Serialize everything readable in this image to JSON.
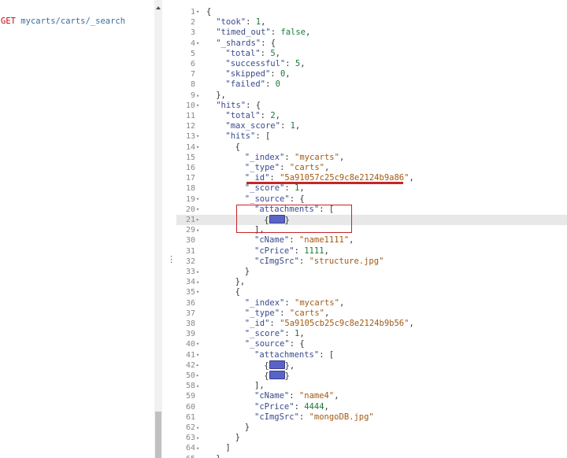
{
  "request": {
    "method": "GET",
    "path": "mycarts/carts/_search"
  },
  "colors": {
    "method": "#c5060b",
    "path": "#3a6e9e",
    "annotation": "#c7242a",
    "folded_badge": "#5a63c7"
  },
  "lines": [
    {
      "n": "1",
      "fold": "down",
      "indent": 0,
      "tokens": [
        [
          "punc",
          "{"
        ]
      ]
    },
    {
      "n": "2",
      "indent": 1,
      "tokens": [
        [
          "key",
          "\"took\""
        ],
        [
          "punc",
          ": "
        ],
        [
          "num",
          "1"
        ],
        [
          "punc",
          ","
        ]
      ]
    },
    {
      "n": "3",
      "indent": 1,
      "tokens": [
        [
          "key",
          "\"timed_out\""
        ],
        [
          "punc",
          ": "
        ],
        [
          "bool",
          "false"
        ],
        [
          "punc",
          ","
        ]
      ]
    },
    {
      "n": "4",
      "fold": "down",
      "indent": 1,
      "tokens": [
        [
          "key",
          "\"_shards\""
        ],
        [
          "punc",
          ": {"
        ]
      ]
    },
    {
      "n": "5",
      "indent": 2,
      "tokens": [
        [
          "key",
          "\"total\""
        ],
        [
          "punc",
          ": "
        ],
        [
          "num",
          "5"
        ],
        [
          "punc",
          ","
        ]
      ]
    },
    {
      "n": "6",
      "indent": 2,
      "tokens": [
        [
          "key",
          "\"successful\""
        ],
        [
          "punc",
          ": "
        ],
        [
          "num",
          "5"
        ],
        [
          "punc",
          ","
        ]
      ]
    },
    {
      "n": "7",
      "indent": 2,
      "tokens": [
        [
          "key",
          "\"skipped\""
        ],
        [
          "punc",
          ": "
        ],
        [
          "num",
          "0"
        ],
        [
          "punc",
          ","
        ]
      ]
    },
    {
      "n": "8",
      "indent": 2,
      "tokens": [
        [
          "key",
          "\"failed\""
        ],
        [
          "punc",
          ": "
        ],
        [
          "num",
          "0"
        ]
      ]
    },
    {
      "n": "9",
      "fold": "up",
      "indent": 1,
      "tokens": [
        [
          "punc",
          "},"
        ]
      ]
    },
    {
      "n": "10",
      "fold": "down",
      "indent": 1,
      "tokens": [
        [
          "key",
          "\"hits\""
        ],
        [
          "punc",
          ": {"
        ]
      ]
    },
    {
      "n": "11",
      "indent": 2,
      "tokens": [
        [
          "key",
          "\"total\""
        ],
        [
          "punc",
          ": "
        ],
        [
          "num",
          "2"
        ],
        [
          "punc",
          ","
        ]
      ]
    },
    {
      "n": "12",
      "indent": 2,
      "tokens": [
        [
          "key",
          "\"max_score\""
        ],
        [
          "punc",
          ": "
        ],
        [
          "num",
          "1"
        ],
        [
          "punc",
          ","
        ]
      ]
    },
    {
      "n": "13",
      "fold": "down",
      "indent": 2,
      "tokens": [
        [
          "key",
          "\"hits\""
        ],
        [
          "punc",
          ": ["
        ]
      ]
    },
    {
      "n": "14",
      "fold": "down",
      "indent": 3,
      "tokens": [
        [
          "punc",
          "{"
        ]
      ]
    },
    {
      "n": "15",
      "indent": 4,
      "tokens": [
        [
          "key",
          "\"_index\""
        ],
        [
          "punc",
          ": "
        ],
        [
          "str",
          "\"mycarts\""
        ],
        [
          "punc",
          ","
        ]
      ]
    },
    {
      "n": "16",
      "indent": 4,
      "tokens": [
        [
          "key",
          "\"_type\""
        ],
        [
          "punc",
          ": "
        ],
        [
          "str",
          "\"carts\""
        ],
        [
          "punc",
          ","
        ]
      ]
    },
    {
      "n": "17",
      "indent": 4,
      "tokens": [
        [
          "key",
          "\"_id\""
        ],
        [
          "punc",
          ": "
        ],
        [
          "str",
          "\"5a91057c25c9c8e2124b9a86\""
        ],
        [
          "punc",
          ","
        ]
      ]
    },
    {
      "n": "18",
      "indent": 4,
      "tokens": [
        [
          "key",
          "\"_score\""
        ],
        [
          "punc",
          ": "
        ],
        [
          "num",
          "1"
        ],
        [
          "punc",
          ","
        ]
      ]
    },
    {
      "n": "19",
      "fold": "down",
      "indent": 4,
      "tokens": [
        [
          "key",
          "\"_source\""
        ],
        [
          "punc",
          ": {"
        ]
      ]
    },
    {
      "n": "20",
      "fold": "down",
      "indent": 5,
      "tokens": [
        [
          "key",
          "\"attachments\""
        ],
        [
          "punc",
          ": ["
        ]
      ]
    },
    {
      "n": "21",
      "fold": "right",
      "indent": 6,
      "active": true,
      "tokens": [
        [
          "punc",
          "{"
        ],
        [
          "badge",
          ""
        ],
        [
          "punc",
          "}"
        ]
      ]
    },
    {
      "n": "29",
      "fold": "up",
      "indent": 5,
      "tokens": [
        [
          "punc",
          "],"
        ]
      ]
    },
    {
      "n": "30",
      "indent": 5,
      "tokens": [
        [
          "key",
          "\"cName\""
        ],
        [
          "punc",
          ": "
        ],
        [
          "str",
          "\"name1111\""
        ],
        [
          "punc",
          ","
        ]
      ]
    },
    {
      "n": "31",
      "indent": 5,
      "tokens": [
        [
          "key",
          "\"cPrice\""
        ],
        [
          "punc",
          ": "
        ],
        [
          "num",
          "1111"
        ],
        [
          "punc",
          ","
        ]
      ]
    },
    {
      "n": "32",
      "indent": 5,
      "tokens": [
        [
          "key",
          "\"cImgSrc\""
        ],
        [
          "punc",
          ": "
        ],
        [
          "str",
          "\"structure.jpg\""
        ]
      ]
    },
    {
      "n": "33",
      "fold": "up",
      "indent": 4,
      "tokens": [
        [
          "punc",
          "}"
        ]
      ]
    },
    {
      "n": "34",
      "fold": "up",
      "indent": 3,
      "tokens": [
        [
          "punc",
          "},"
        ]
      ]
    },
    {
      "n": "35",
      "fold": "down",
      "indent": 3,
      "tokens": [
        [
          "punc",
          "{"
        ]
      ]
    },
    {
      "n": "36",
      "indent": 4,
      "tokens": [
        [
          "key",
          "\"_index\""
        ],
        [
          "punc",
          ": "
        ],
        [
          "str",
          "\"mycarts\""
        ],
        [
          "punc",
          ","
        ]
      ]
    },
    {
      "n": "37",
      "indent": 4,
      "tokens": [
        [
          "key",
          "\"_type\""
        ],
        [
          "punc",
          ": "
        ],
        [
          "str",
          "\"carts\""
        ],
        [
          "punc",
          ","
        ]
      ]
    },
    {
      "n": "38",
      "indent": 4,
      "tokens": [
        [
          "key",
          "\"_id\""
        ],
        [
          "punc",
          ": "
        ],
        [
          "str",
          "\"5a9105cb25c9c8e2124b9b56\""
        ],
        [
          "punc",
          ","
        ]
      ]
    },
    {
      "n": "39",
      "indent": 4,
      "tokens": [
        [
          "key",
          "\"_score\""
        ],
        [
          "punc",
          ": "
        ],
        [
          "num",
          "1"
        ],
        [
          "punc",
          ","
        ]
      ]
    },
    {
      "n": "40",
      "fold": "down",
      "indent": 4,
      "tokens": [
        [
          "key",
          "\"_source\""
        ],
        [
          "punc",
          ": {"
        ]
      ]
    },
    {
      "n": "41",
      "fold": "down",
      "indent": 5,
      "tokens": [
        [
          "key",
          "\"attachments\""
        ],
        [
          "punc",
          ": ["
        ]
      ]
    },
    {
      "n": "42",
      "fold": "right",
      "indent": 6,
      "tokens": [
        [
          "punc",
          "{"
        ],
        [
          "badge",
          ""
        ],
        [
          "punc",
          "},"
        ]
      ]
    },
    {
      "n": "50",
      "fold": "right",
      "indent": 6,
      "tokens": [
        [
          "punc",
          "{"
        ],
        [
          "badge",
          ""
        ],
        [
          "punc",
          "}"
        ]
      ]
    },
    {
      "n": "58",
      "fold": "up",
      "indent": 5,
      "tokens": [
        [
          "punc",
          "],"
        ]
      ]
    },
    {
      "n": "59",
      "indent": 5,
      "tokens": [
        [
          "key",
          "\"cName\""
        ],
        [
          "punc",
          ": "
        ],
        [
          "str",
          "\"name4\""
        ],
        [
          "punc",
          ","
        ]
      ]
    },
    {
      "n": "60",
      "indent": 5,
      "tokens": [
        [
          "key",
          "\"cPrice\""
        ],
        [
          "punc",
          ": "
        ],
        [
          "num",
          "4444"
        ],
        [
          "punc",
          ","
        ]
      ]
    },
    {
      "n": "61",
      "indent": 5,
      "tokens": [
        [
          "key",
          "\"cImgSrc\""
        ],
        [
          "punc",
          ": "
        ],
        [
          "str",
          "\"mongoDB.jpg\""
        ]
      ]
    },
    {
      "n": "62",
      "fold": "up",
      "indent": 4,
      "tokens": [
        [
          "punc",
          "}"
        ]
      ]
    },
    {
      "n": "63",
      "fold": "up",
      "indent": 3,
      "tokens": [
        [
          "punc",
          "}"
        ]
      ]
    },
    {
      "n": "64",
      "fold": "up",
      "indent": 2,
      "tokens": [
        [
          "punc",
          "]"
        ]
      ]
    },
    {
      "n": "65",
      "fold": "up",
      "indent": 1,
      "tokens": [
        [
          "punc",
          "}"
        ]
      ]
    }
  ]
}
